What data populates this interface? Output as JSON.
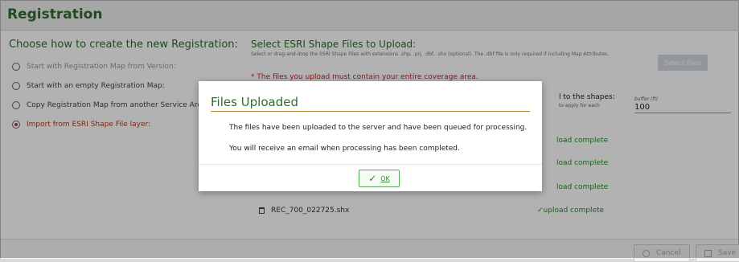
{
  "header": {
    "title": "Registration"
  },
  "left": {
    "title": "Choose how to create the new Registration:",
    "options": [
      {
        "label": "Start with Registration Map from Version:",
        "selected": false
      },
      {
        "label": "Start with an empty Registration Map:",
        "selected": false
      },
      {
        "label": "Copy Registration Map from another Service Are",
        "selected": false
      },
      {
        "label": "Import from ESRI Shape File layer:",
        "selected": true
      }
    ]
  },
  "right": {
    "title": "Select ESRI Shape Files to Upload:",
    "help": "Select or drag-and-drop the ESRI Shape Files with extensions .shp, .prj, .dbf, .shx (optional). The .dbf file is only required if including Map Attributes.",
    "select_files_label": "Select Files",
    "warning": "* The files you upload must contain your entire coverage area.",
    "shapes_label": "l to the shapes:",
    "shapes_sub": "to apply for each",
    "buffer_label": "buffer (ft)",
    "buffer_value": "100",
    "partial_statuses": [
      "load complete",
      "load complete",
      "load complete"
    ],
    "file_name": "REC_700_022725.shx",
    "file_status": "✓upload complete"
  },
  "footer": {
    "cancel_label": "Cancel",
    "save_label": "Save"
  },
  "dialog": {
    "title": "Files Uploaded",
    "line1": "The files have been uploaded to the server and have been queued for processing.",
    "line2": "You will receive an email when processing has been completed.",
    "ok_label": "OK"
  },
  "colors": {
    "accent": "#2e6b2e",
    "warning": "#cc2222",
    "success": "#2e8b2e"
  },
  "icons": {
    "radio": "radio-icon",
    "trash": "trash-icon",
    "check": "check-icon",
    "cancel": "cancel-icon",
    "save": "save-icon"
  }
}
